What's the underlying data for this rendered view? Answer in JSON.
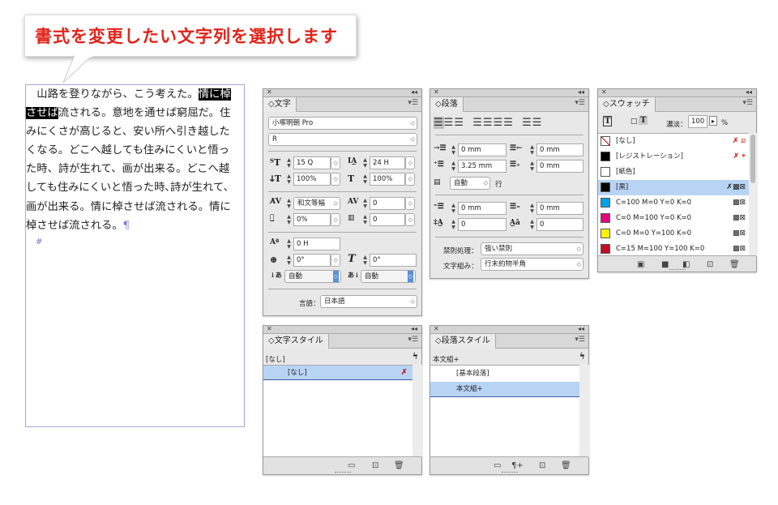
{
  "callout": {
    "text": "書式を変更したい文字列を選択します"
  },
  "text_frame": {
    "lines": [
      {
        "pre": "　山路を登りながら、こう考えた。",
        "sel": "情に棹",
        "post": ""
      },
      {
        "pre": "",
        "sel": "させば",
        "post": "流される。意地を通せば窮屈だ。住"
      },
      {
        "pre": "みにくさが高じると、安い所へ引き越した",
        "sel": "",
        "post": ""
      },
      {
        "pre": "くなる。どこへ越しても住みにくいと悟っ",
        "sel": "",
        "post": ""
      },
      {
        "pre": "た時、詩が生れて、画が出来る。どこへ越",
        "sel": "",
        "post": ""
      },
      {
        "pre": "しても住みにくいと悟った時､詩が生れて、",
        "sel": "",
        "post": ""
      },
      {
        "pre": "画が出来る。情に棹させば流される。情に",
        "sel": "",
        "post": ""
      },
      {
        "pre": "棹させば流される。",
        "sel": "",
        "post": "¶"
      }
    ],
    "end_mark": "#"
  },
  "character_panel": {
    "tab": "◇文字",
    "font_family": "小塚明朝 Pro",
    "font_style": "R",
    "size": "15 Q",
    "leading": "24 H",
    "vertical_scale": "100%",
    "horizontal_scale": "100%",
    "kerning": "和文等幅",
    "tracking": "0",
    "tsume": "0%",
    "grid_align": "0",
    "baseline_shift": "0 H",
    "rotation": "0°",
    "skew": "0°",
    "aki_before": "自動",
    "aki_after": "自動",
    "language_label": "言語：",
    "language": "日本語"
  },
  "paragraph_panel": {
    "tab": "◇段落",
    "left_indent": "0 mm",
    "right_indent": "0 mm",
    "first_indent": "3.25 mm",
    "last_indent": "0 mm",
    "drop_lines": "自動",
    "drop_unit": "行",
    "space_before": "0 mm",
    "space_after": "0 mm",
    "drop_cap_lines": "0",
    "drop_cap_chars": "0",
    "kinsoku_label": "禁則処理：",
    "kinsoku": "強い禁則",
    "mojikumi_label": "文字組み：",
    "mojikumi": "行末約物半角"
  },
  "swatch_panel": {
    "tab": "◇スウォッチ",
    "tint_label": "濃淡：",
    "tint": "100",
    "tint_unit": "%",
    "swatches": [
      {
        "name": "[なし]",
        "color": "none"
      },
      {
        "name": "[レジストレーション]",
        "color": "#000000"
      },
      {
        "name": "[紙色]",
        "color": "#ffffff"
      },
      {
        "name": "[黒]",
        "color": "#000000"
      },
      {
        "name": "C=100 M=0 Y=0 K=0",
        "color": "#00a0e9"
      },
      {
        "name": "C=0 M=100 Y=0 K=0",
        "color": "#e4007f"
      },
      {
        "name": "C=0 M=0 Y=100 K=0",
        "color": "#fff100"
      },
      {
        "name": "C=15 M=100 Y=100 K=0",
        "color": "#c30d23"
      }
    ]
  },
  "char_style_panel": {
    "tab": "◇文字スタイル",
    "current": "[なし]",
    "items": [
      "[なし]"
    ]
  },
  "para_style_panel": {
    "tab": "◇段落スタイル",
    "current": "本文組+",
    "items": [
      "[基本段落]",
      "本文組+"
    ]
  }
}
